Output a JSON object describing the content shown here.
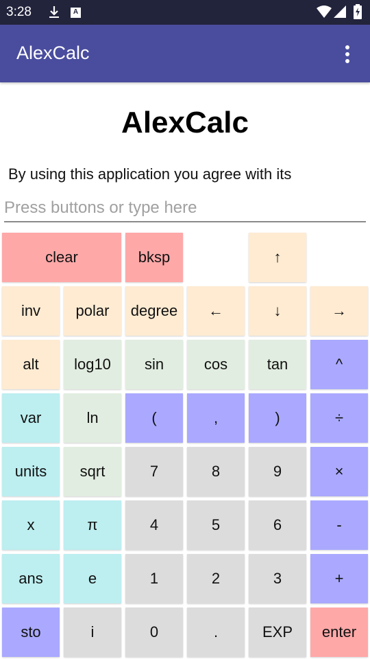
{
  "status_bar": {
    "time": "3:28",
    "icons": [
      "download-icon",
      "a-notification-icon",
      "wifi-icon",
      "cell-signal-icon",
      "battery-charging-icon"
    ],
    "a_icon_letter": "A"
  },
  "app_bar": {
    "title": "AlexCalc",
    "menu_icon": "more-vert-icon",
    "color": "#4a4d9e"
  },
  "main": {
    "heading": "AlexCalc",
    "agreement_text": "By using this application you agree with its",
    "input": {
      "value": "",
      "placeholder": "Press buttons or type here"
    }
  },
  "colors": {
    "red": "#ffa8a8",
    "orange": "#feebd2",
    "green": "#e1ede0",
    "cyan": "#bdeef0",
    "blue": "#aaa9ff",
    "gray": "#dcdcdc"
  },
  "keypad": {
    "rows": [
      [
        {
          "label": "clear",
          "name": "clear",
          "color": "red",
          "col": 0,
          "span": 2
        },
        {
          "label": "bksp",
          "name": "backspace",
          "color": "red",
          "col": 2
        },
        {
          "label": "↑",
          "name": "up-arrow",
          "color": "orange",
          "col": 4
        }
      ],
      [
        {
          "label": "inv",
          "name": "inv",
          "color": "orange",
          "col": 0
        },
        {
          "label": "polar",
          "name": "polar",
          "color": "orange",
          "col": 1
        },
        {
          "label": "degree",
          "name": "degree",
          "color": "orange",
          "col": 2
        },
        {
          "label": "←",
          "name": "left-arrow",
          "color": "orange",
          "col": 3
        },
        {
          "label": "↓",
          "name": "down-arrow",
          "color": "orange",
          "col": 4
        },
        {
          "label": "→",
          "name": "right-arrow",
          "color": "orange",
          "col": 5
        }
      ],
      [
        {
          "label": "alt",
          "name": "alt",
          "color": "orange",
          "col": 0
        },
        {
          "label": "log",
          "sub": "10",
          "name": "log10",
          "color": "green",
          "col": 1
        },
        {
          "label": "sin",
          "name": "sin",
          "color": "green",
          "col": 2
        },
        {
          "label": "cos",
          "name": "cos",
          "color": "green",
          "col": 3
        },
        {
          "label": "tan",
          "name": "tan",
          "color": "green",
          "col": 4
        },
        {
          "label": "^",
          "name": "power",
          "color": "blue",
          "col": 5
        }
      ],
      [
        {
          "label": "var",
          "name": "var",
          "color": "cyan",
          "col": 0
        },
        {
          "label": "ln",
          "name": "ln",
          "color": "green",
          "col": 1
        },
        {
          "label": "(",
          "name": "open-paren",
          "color": "blue",
          "col": 2
        },
        {
          "label": ",",
          "name": "comma",
          "color": "blue",
          "col": 3
        },
        {
          "label": ")",
          "name": "close-paren",
          "color": "blue",
          "col": 4
        },
        {
          "label": "÷",
          "name": "divide",
          "color": "blue",
          "col": 5
        }
      ],
      [
        {
          "label": "units",
          "name": "units",
          "color": "cyan",
          "col": 0
        },
        {
          "label": "sqrt",
          "name": "sqrt",
          "color": "green",
          "col": 1
        },
        {
          "label": "7",
          "name": "digit-7",
          "color": "gray",
          "col": 2
        },
        {
          "label": "8",
          "name": "digit-8",
          "color": "gray",
          "col": 3
        },
        {
          "label": "9",
          "name": "digit-9",
          "color": "gray",
          "col": 4
        },
        {
          "label": "×",
          "name": "multiply",
          "color": "blue",
          "col": 5
        }
      ],
      [
        {
          "label": "x",
          "name": "x-variable",
          "color": "cyan",
          "col": 0
        },
        {
          "label": "π",
          "name": "pi",
          "color": "cyan",
          "col": 1
        },
        {
          "label": "4",
          "name": "digit-4",
          "color": "gray",
          "col": 2
        },
        {
          "label": "5",
          "name": "digit-5",
          "color": "gray",
          "col": 3
        },
        {
          "label": "6",
          "name": "digit-6",
          "color": "gray",
          "col": 4
        },
        {
          "label": "-",
          "name": "subtract",
          "color": "blue",
          "col": 5
        }
      ],
      [
        {
          "label": "ans",
          "name": "ans",
          "color": "cyan",
          "col": 0
        },
        {
          "label": "e",
          "name": "euler-e",
          "color": "cyan",
          "col": 1
        },
        {
          "label": "1",
          "name": "digit-1",
          "color": "gray",
          "col": 2
        },
        {
          "label": "2",
          "name": "digit-2",
          "color": "gray",
          "col": 3
        },
        {
          "label": "3",
          "name": "digit-3",
          "color": "gray",
          "col": 4
        },
        {
          "label": "+",
          "name": "add",
          "color": "blue",
          "col": 5
        }
      ],
      [
        {
          "label": "sto",
          "name": "store",
          "color": "blue",
          "col": 0
        },
        {
          "label": "i",
          "name": "imaginary-i",
          "color": "gray",
          "col": 1
        },
        {
          "label": "0",
          "name": "digit-0",
          "color": "gray",
          "col": 2
        },
        {
          "label": ".",
          "name": "decimal-point",
          "color": "gray",
          "col": 3
        },
        {
          "label": "EXP",
          "name": "exp",
          "color": "gray",
          "col": 4
        },
        {
          "label": "enter",
          "name": "enter",
          "color": "red",
          "col": 5
        }
      ]
    ]
  }
}
